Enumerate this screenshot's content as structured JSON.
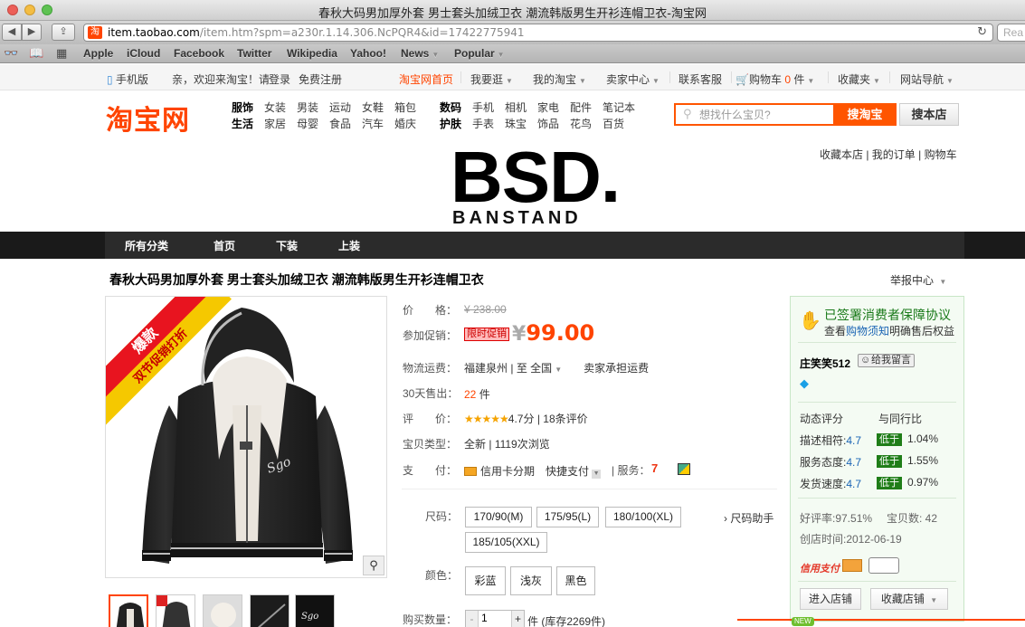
{
  "window": {
    "title": "春秋大码男加厚外套 男士套头加绒卫衣 潮流韩版男生开衫连帽卫衣-淘宝网"
  },
  "browser": {
    "url_host": "item.taobao.com",
    "url_path": "/item.htm?spm=a230r.1.14.306.NcPQR4&id=17422775941",
    "favicon_text": "淘",
    "reader": "Rea",
    "bookmarks": [
      "Apple",
      "iCloud",
      "Facebook",
      "Twitter",
      "Wikipedia",
      "Yahoo!",
      "News",
      "Popular"
    ]
  },
  "sitebar": {
    "mobile": "手机版",
    "greeting": "亲，欢迎来淘宝！请",
    "login": "登录",
    "register": "免费注册",
    "home": "淘宝网首页",
    "buy": "我要逛",
    "my_taobao": "我的淘宝",
    "seller_center": "卖家中心",
    "service": "联系客服",
    "cart": "购物车",
    "cart_count": "0",
    "cart_unit": "件",
    "favorites": "收藏夹",
    "site_nav": "网站导航"
  },
  "header": {
    "logo": "淘宝网",
    "categories_row1": [
      "服饰",
      "女装",
      "男装",
      "运动",
      "女鞋",
      "箱包",
      "数码",
      "手机",
      "相机",
      "家电",
      "配件",
      "笔记本"
    ],
    "categories_row2": [
      "生活",
      "家居",
      "母婴",
      "食品",
      "汽车",
      "婚庆",
      "护肤",
      "手表",
      "珠宝",
      "饰品",
      "花鸟",
      "百货"
    ],
    "search_placeholder": "想找什么宝贝?",
    "search_btn": "搜淘宝",
    "store_search_btn": "搜本店",
    "shop_links": "收藏本店 | 我的订单 | 购物车"
  },
  "brand": {
    "name": "BSD.",
    "sub": "BANSTAND"
  },
  "shop_nav": [
    "所有分类",
    "首页",
    "下装",
    "上装"
  ],
  "product": {
    "title": "春秋大码男加厚外套 男士套头加绒卫衣 潮流韩版男生开衫连帽卫衣",
    "report": "举报中心",
    "ribbon_top": "爆款",
    "ribbon_bottom": "双节促销打折",
    "price_label": "价　　格：",
    "price_orig": "¥ 238.00",
    "promo_label": "参加促销：",
    "promo_tag": "限时促销",
    "price_symbol": "¥",
    "price_now": "99.00",
    "ship_label": "物流运费：",
    "ship_from": "福建泉州",
    "ship_to_prefix": "至",
    "ship_to": "全国",
    "ship_note": "卖家承担运费",
    "sold_label": "30天售出：",
    "sold_count": "22",
    "sold_unit": "件",
    "rating_label": "评　　价：",
    "stars": "★★★★★",
    "rating_score": "4.7分",
    "review_count": "18条评价",
    "type_label": "宝贝类型：",
    "type_value": "全新",
    "views": "1119次浏览",
    "pay_label": "支　　付：",
    "pay_installment": "信用卡分期",
    "pay_quick": "快捷支付",
    "service_label": "服务：",
    "size_label": "尺码：",
    "sizes": [
      "170/90(M)",
      "175/95(L)",
      "180/100(XL)",
      "185/105(XXL)"
    ],
    "size_helper": "尺码助手",
    "color_label": "颜色：",
    "colors": [
      "彩蓝",
      "浅灰",
      "黑色"
    ],
    "qty_label": "购买数量：",
    "qty_value": "1",
    "qty_unit": "件",
    "stock": "(库存2269件)"
  },
  "seller": {
    "guarantee_title": "已签署消费者保障协议",
    "guarantee_pre": "查看",
    "guarantee_link": "购物须知",
    "guarantee_post": "明确售后权益",
    "name": "庄笑笑512",
    "msg_btn": "给我留言",
    "dsr_title": "动态评分",
    "compare_title": "与同行比",
    "desc_label": "描述相符:",
    "desc_score": "4.7",
    "desc_badge": "低于",
    "desc_pct": "1.04%",
    "service_label": "服务态度:",
    "service_score": "4.7",
    "service_badge": "低于",
    "service_pct": "1.55%",
    "ship_label": "发货速度:",
    "ship_score": "4.7",
    "ship_badge": "低于",
    "ship_pct": "0.97%",
    "good_rate": "好评率:97.51%",
    "item_count": "宝贝数: 42",
    "created": "创店时间:2012-06-19",
    "credit_pay": "信用支付",
    "enter_shop": "进入店铺",
    "fav_shop": "收藏店铺",
    "new_badge": "NEW"
  }
}
